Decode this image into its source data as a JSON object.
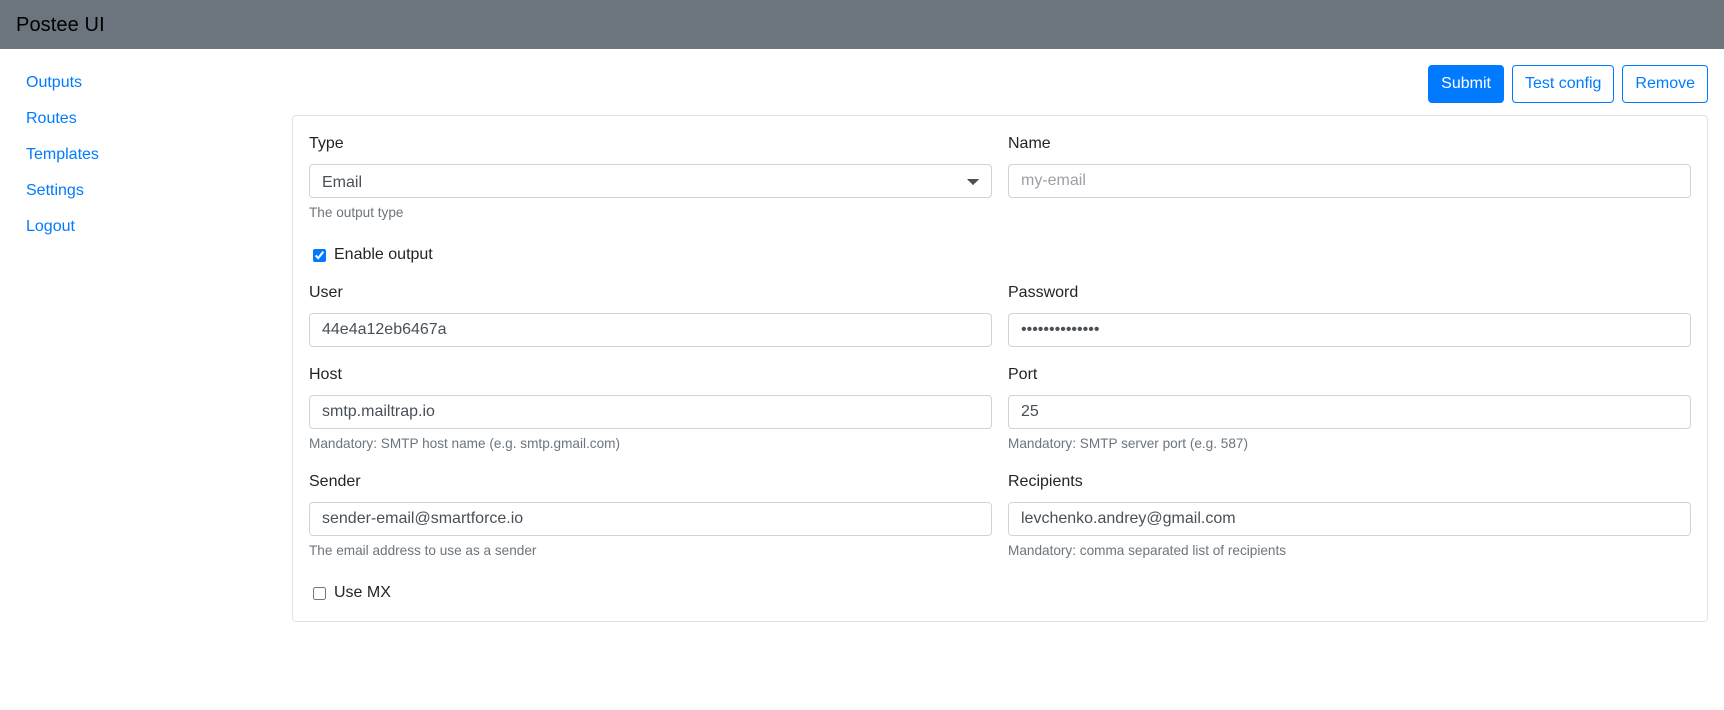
{
  "navbar": {
    "brand": "Postee UI"
  },
  "sidebar": {
    "items": [
      {
        "label": "Outputs"
      },
      {
        "label": "Routes"
      },
      {
        "label": "Templates"
      },
      {
        "label": "Settings"
      },
      {
        "label": "Logout"
      }
    ]
  },
  "toolbar": {
    "submit_label": "Submit",
    "test_config_label": "Test config",
    "remove_label": "Remove"
  },
  "form": {
    "type": {
      "label": "Type",
      "value": "Email",
      "options": [
        "Email"
      ],
      "help": "The output type"
    },
    "name": {
      "label": "Name",
      "value": "",
      "placeholder": "my-email"
    },
    "enable_output": {
      "label": "Enable output",
      "checked": true
    },
    "user": {
      "label": "User",
      "value": "44e4a12eb6467a",
      "placeholder": ""
    },
    "password": {
      "label": "Password",
      "value": "••••••••••••••",
      "masked_length": 14,
      "placeholder": ""
    },
    "host": {
      "label": "Host",
      "value": "smtp.mailtrap.io",
      "help": "Mandatory: SMTP host name (e.g. smtp.gmail.com)"
    },
    "port": {
      "label": "Port",
      "value": "25",
      "help": "Mandatory: SMTP server port (e.g. 587)"
    },
    "sender": {
      "label": "Sender",
      "value": "sender-email@smartforce.io",
      "help": "The email address to use as a sender"
    },
    "recipients": {
      "label": "Recipients",
      "value": "levchenko.andrey@gmail.com",
      "help": "Mandatory: comma separated list of recipients"
    },
    "use_mx": {
      "label": "Use MX",
      "checked": false
    }
  },
  "colors": {
    "navbar_bg": "#6c757d",
    "accent": "#007bff",
    "muted_text": "#6c757d",
    "border": "#dee2e6",
    "input_border": "#ced4da"
  }
}
